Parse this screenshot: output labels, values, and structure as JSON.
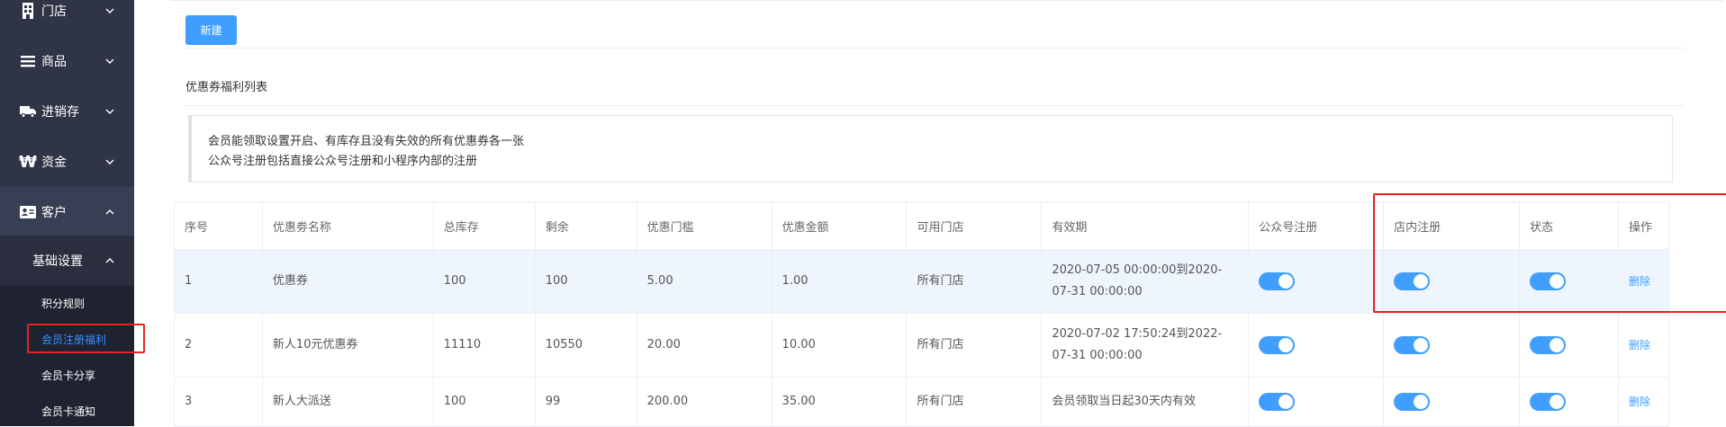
{
  "sidebar": {
    "items": [
      {
        "label": "门店",
        "icon": "store-icon"
      },
      {
        "label": "商品",
        "icon": "list-icon"
      },
      {
        "label": "进销存",
        "icon": "truck-icon"
      },
      {
        "label": "资金",
        "icon": "won-icon"
      },
      {
        "label": "客户",
        "icon": "id-card-icon"
      }
    ],
    "submenu_title": "基础设置",
    "submenu_items": [
      "积分规则",
      "会员注册福利",
      "会员卡分享",
      "会员卡通知"
    ],
    "active_item": "会员注册福利"
  },
  "main": {
    "new_button": "新建",
    "section_title": "优惠券福利列表",
    "notice": [
      "会员能领取设置开启、有库存且没有失效的所有优惠券各一张",
      "公众号注册包括直接公众号注册和小程序内部的注册"
    ],
    "table": {
      "headers": [
        "序号",
        "优惠劵名称",
        "总库存",
        "剩余",
        "优惠门槛",
        "优惠金额",
        "可用门店",
        "有效期",
        "公众号注册",
        "店内注册",
        "状态",
        "操作"
      ],
      "rows": [
        {
          "no": "1",
          "name": "优惠券",
          "total": "100",
          "remain": "100",
          "threshold": "5.00",
          "amount": "1.00",
          "store": "所有门店",
          "validity": "2020-07-05 00:00:00到2020-07-31 00:00:00",
          "action": "删除"
        },
        {
          "no": "2",
          "name": "新人10元优惠券",
          "total": "11110",
          "remain": "10550",
          "threshold": "20.00",
          "amount": "10.00",
          "store": "所有门店",
          "validity": "2020-07-02 17:50:24到2022-07-31 00:00:00",
          "action": "删除"
        },
        {
          "no": "3",
          "name": "新人大派送",
          "total": "100",
          "remain": "99",
          "threshold": "200.00",
          "amount": "35.00",
          "store": "所有门店",
          "validity": "会员领取当日起30天内有效",
          "action": "删除"
        }
      ]
    }
  },
  "colors": {
    "sidebar_bg": "#2f3447",
    "accent": "#409eff",
    "highlight_box": "#e52323",
    "active_link": "#3a93ff"
  }
}
